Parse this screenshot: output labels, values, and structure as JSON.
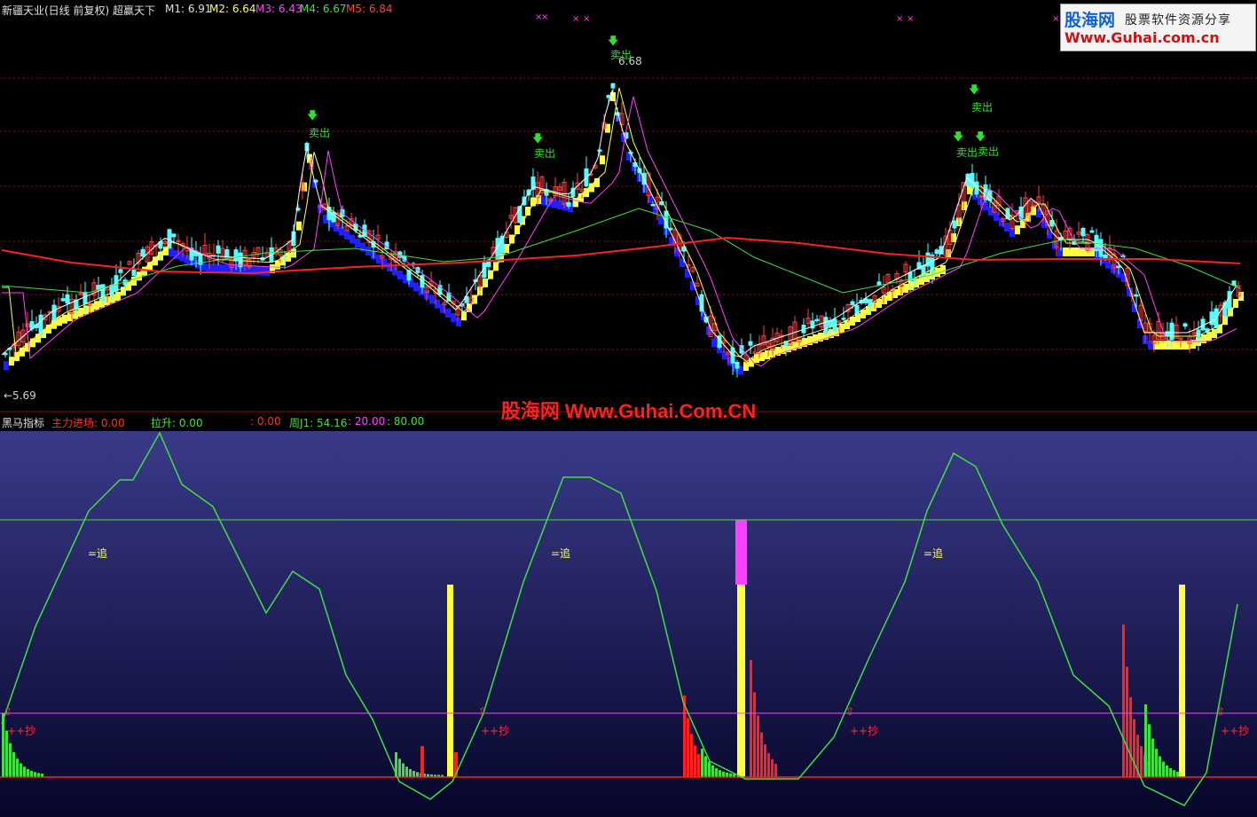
{
  "header": {
    "stock_title": "新疆天业(日线 前复权) 超赢天下",
    "m1": "M1: 6.91",
    "m2": "M2: 6.64",
    "m3": "M3: 6.43",
    "m4": "M4: 6.67",
    "m5": "M5: 6.84"
  },
  "ad": {
    "brand": "股海网",
    "tagline": "股票软件资源分享",
    "url": "Www.Guhai.com.cn"
  },
  "price_chart": {
    "high_label": "6.68",
    "low_label": "←5.69",
    "sell_label": "卖出",
    "sell_signals": [
      "卖出",
      "卖出",
      "卖出",
      "卖出",
      "卖出",
      "卖出"
    ],
    "markers": [
      "×",
      "×",
      "×",
      "×",
      "×",
      "×",
      "×"
    ]
  },
  "watermark": "股海网 Www.Guhai.Com.CN",
  "indicator": {
    "name": "黑马指标",
    "zhuli_label": "主力进场: 0.00",
    "lasheng_label": "拉升: 0.00",
    "extra_label": ": 0.00",
    "zhouj_label": "周J1: 54.16",
    "level_mid": ": 20.00",
    "level_high": ": 80.00",
    "chase_label": "=追",
    "buy_label": "++抄"
  },
  "colors": {
    "up_candle": "#ff4040",
    "down_candle": "#54ffff",
    "yellow_band": "#ffff40",
    "blue_band": "#2020ff",
    "ma_long": "#ff2020",
    "indicator_bg_top": "#3a3a8a",
    "indicator_bg_bottom": "#06062a",
    "kdj_line": "#40e040",
    "magenta": "#ff40ff"
  }
}
